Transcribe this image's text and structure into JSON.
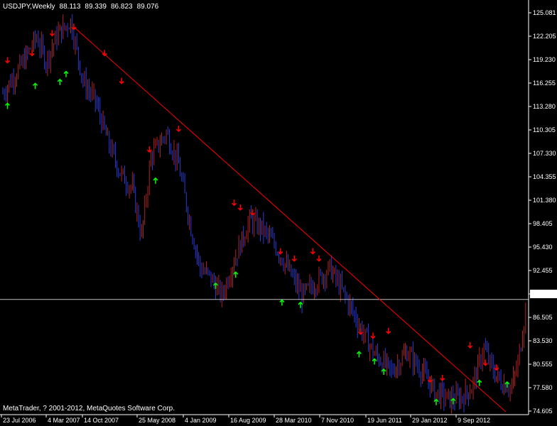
{
  "header": {
    "symbol_timeframe": "USDJPY,Weekly",
    "ohlc": [
      "88.113",
      "89.339",
      "86.823",
      "89.076"
    ]
  },
  "footer": {
    "copyright": "MetaTrader, ? 2001-2012, MetaQuotes Software Corp."
  },
  "colors": {
    "background": "#000000",
    "bull_bar": "#b22222",
    "bear_bar": "#2a3bd6",
    "trendline": "#ff0000",
    "price_line": "#c0c0c0",
    "axis": "#ffffff",
    "up_arrow": "#00ff00",
    "down_arrow": "#ff0000"
  },
  "chart_data": {
    "type": "bar",
    "ylim": [
      74.605,
      125.081
    ],
    "y_ticks": [
      "125.081",
      "122.205",
      "119.230",
      "116.255",
      "113.280",
      "110.305",
      "107.330",
      "104.355",
      "101.380",
      "98.405",
      "95.430",
      "92.455",
      "89.076",
      "86.505",
      "83.530",
      "80.555",
      "77.580",
      "74.605"
    ],
    "x_ticks": [
      "23 Jul 2006",
      "4 Mar 2007",
      "14 Oct 2007",
      "25 May 2008",
      "4 Jan 2009",
      "16 Aug 2009",
      "28 Mar 2010",
      "7 Nov 2010",
      "19 Jun 2011",
      "29 Jan 2012",
      "9 Sep 2012"
    ],
    "current_price": 89.076,
    "trendline": [
      [
        "4 Mar 2007",
        123.8
      ],
      [
        "9 Sep 2012",
        74.6
      ]
    ],
    "bar_count": 340,
    "price_path": [
      [
        0,
        115.0
      ],
      [
        12,
        118.5
      ],
      [
        22,
        122.0
      ],
      [
        28,
        119.0
      ],
      [
        36,
        122.5
      ],
      [
        44,
        124.0
      ],
      [
        52,
        116.5
      ],
      [
        60,
        114.0
      ],
      [
        68,
        109.0
      ],
      [
        76,
        105.0
      ],
      [
        84,
        103.0
      ],
      [
        90,
        97.0
      ],
      [
        96,
        107.0
      ],
      [
        106,
        110.0
      ],
      [
        114,
        106.0
      ],
      [
        122,
        98.0
      ],
      [
        128,
        93.0
      ],
      [
        134,
        92.0
      ],
      [
        142,
        89.5
      ],
      [
        150,
        94.0
      ],
      [
        160,
        99.0
      ],
      [
        168,
        98.0
      ],
      [
        176,
        96.0
      ],
      [
        186,
        92.5
      ],
      [
        194,
        89.5
      ],
      [
        202,
        91.0
      ],
      [
        212,
        93.0
      ],
      [
        222,
        89.5
      ],
      [
        232,
        85.5
      ],
      [
        240,
        82.5
      ],
      [
        252,
        80.0
      ],
      [
        262,
        82.5
      ],
      [
        272,
        80.0
      ],
      [
        280,
        77.5
      ],
      [
        290,
        76.5
      ],
      [
        298,
        76.8
      ],
      [
        304,
        78.0
      ],
      [
        312,
        83.0
      ],
      [
        318,
        80.0
      ],
      [
        324,
        78.5
      ],
      [
        330,
        78.0
      ],
      [
        334,
        81.0
      ],
      [
        340,
        89.0
      ]
    ],
    "fractal_arrows": [
      {
        "bar": 4,
        "type": "down",
        "price": 118.8
      },
      {
        "bar": 3,
        "type": "up",
        "price": 113.0
      },
      {
        "bar": 22,
        "type": "down",
        "price": 119.7
      },
      {
        "bar": 25,
        "type": "up",
        "price": 115.5
      },
      {
        "bar": 38,
        "type": "down",
        "price": 122.2
      },
      {
        "bar": 44,
        "type": "up",
        "price": 116.0
      },
      {
        "bar": 48,
        "type": "up",
        "price": 117.0
      },
      {
        "bar": 54,
        "type": "down",
        "price": 123.0
      },
      {
        "bar": 78,
        "type": "down",
        "price": 119.7
      },
      {
        "bar": 90,
        "type": "down",
        "price": 116.2
      },
      {
        "bar": 112,
        "type": "down",
        "price": 107.6
      },
      {
        "bar": 116,
        "type": "up",
        "price": 103.6
      },
      {
        "bar": 134,
        "type": "down",
        "price": 110.2
      },
      {
        "bar": 162,
        "type": "up",
        "price": 90.4
      },
      {
        "bar": 176,
        "type": "down",
        "price": 100.9
      },
      {
        "bar": 181,
        "type": "down",
        "price": 100.3
      },
      {
        "bar": 178,
        "type": "up",
        "price": 91.8
      },
      {
        "bar": 190,
        "type": "down",
        "price": 99.7
      },
      {
        "bar": 212,
        "type": "down",
        "price": 94.8
      },
      {
        "bar": 213,
        "type": "up",
        "price": 88.3
      },
      {
        "bar": 222,
        "type": "down",
        "price": 93.9
      },
      {
        "bar": 227,
        "type": "up",
        "price": 88.0
      },
      {
        "bar": 237,
        "type": "down",
        "price": 94.8
      },
      {
        "bar": 241,
        "type": "down",
        "price": 93.9
      },
      {
        "bar": 273,
        "type": "down",
        "price": 84.7
      },
      {
        "bar": 272,
        "type": "up",
        "price": 81.8
      },
      {
        "bar": 282,
        "type": "down",
        "price": 84.2
      },
      {
        "bar": 283,
        "type": "up",
        "price": 80.9
      },
      {
        "bar": 290,
        "type": "up",
        "price": 79.6
      },
      {
        "bar": 294,
        "type": "down",
        "price": 84.8
      },
      {
        "bar": 326,
        "type": "down",
        "price": 78.7
      },
      {
        "bar": 330,
        "type": "up",
        "price": 75.8
      },
      {
        "bar": 335,
        "type": "down",
        "price": 78.9
      },
      {
        "bar": 344,
        "type": "up",
        "price": 75.9
      },
      {
        "bar": 356,
        "type": "down",
        "price": 83.0
      },
      {
        "bar": 364,
        "type": "up",
        "price": 78.2
      },
      {
        "bar": 368,
        "type": "down",
        "price": 80.8
      },
      {
        "bar": 376,
        "type": "down",
        "price": 80.2
      },
      {
        "bar": 385,
        "type": "up",
        "price": 78.0
      }
    ]
  }
}
